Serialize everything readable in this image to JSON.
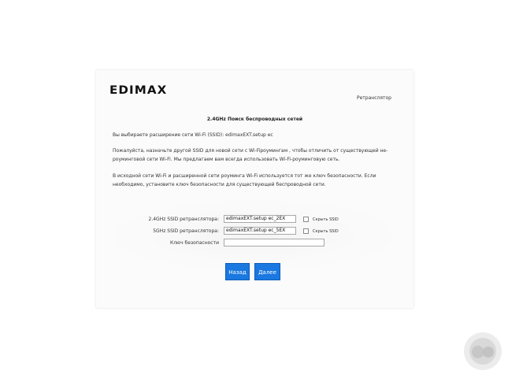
{
  "header": {
    "logo_text": "EDIMAX",
    "mode_label": "Ретранслятор"
  },
  "page": {
    "title": "2.4GHz Поиск беспроводных сетей",
    "selected_text": "Вы выбираете расширение сети Wi-Fi (SSID):  edimaxEXT.setup ec",
    "instruction_text": "Пожалуйста, назначьте другой SSID для новой сети с Wi-Fiроумингам , чтобы отличить от существующей не-роуминговой сети Wi-Fi. Мы предлагаем вам всегда использовать Wi-Fi-роуминговую сеть.",
    "security_text": "В исходной сети Wi-Fi и расширенной сети роуминга Wi-Fi используется тот же ключ безопасности. Если необходимо, установите ключ безопасности для существующей беспроводной сети."
  },
  "form": {
    "ssid24": {
      "label": "2.4GHz SSID ретранслятора:",
      "value": "edimaxEXT.setup ec_2EX",
      "hide_label": "Скрыть SSID"
    },
    "ssid5": {
      "label": "5GHz SSID ретранслятора:",
      "value": "edimaxEXT.setup ec_5EX",
      "hide_label": "Скрыть SSID"
    },
    "key": {
      "label": "Ключ безопасности",
      "value": ""
    }
  },
  "buttons": {
    "back": "Назад",
    "next": "Далее"
  },
  "colors": {
    "button": "#1a78e0"
  }
}
